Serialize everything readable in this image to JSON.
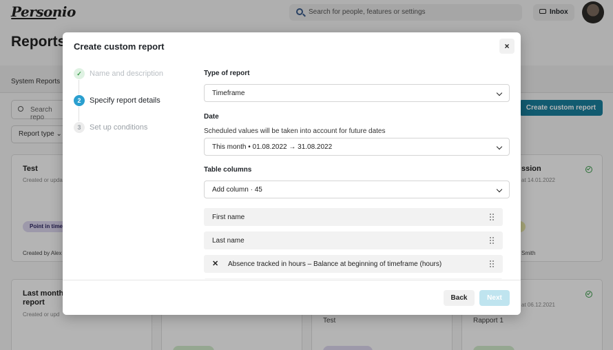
{
  "app": {
    "logo": "Personio",
    "search_placeholder": "Search for people, features or settings",
    "inbox_label": "Inbox",
    "page_title": "Reports",
    "tab_system_reports": "System Reports",
    "search_reports_placeholder": "Search repo",
    "report_type_filter": "Report type",
    "create_button": "Create custom report",
    "cards": [
      {
        "title": "Test",
        "subtitle": "Created or upda",
        "badge": "Point in time",
        "footer": "Created by Alex"
      },
      {
        "title": "ssion",
        "subtitle": "at 14.01.2022",
        "footer": "Smith"
      },
      {
        "title": "Last month report",
        "subtitle": "Created or upd"
      },
      {
        "title": "Test"
      },
      {
        "title": "Rapport 1",
        "subtitle": "at 06.12.2021"
      }
    ]
  },
  "modal": {
    "title": "Create custom report",
    "close_label": "×",
    "steps": [
      {
        "number": "✓",
        "label": "Name and description",
        "state": "done"
      },
      {
        "number": "2",
        "label": "Specify report details",
        "state": "active"
      },
      {
        "number": "3",
        "label": "Set up conditions",
        "state": "pending"
      }
    ],
    "type_of_report": {
      "label": "Type of report",
      "value": "Timeframe"
    },
    "date": {
      "label": "Date",
      "help": "Scheduled values will be taken into account for future dates",
      "value": "This month • 01.08.2022 → 31.08.2022"
    },
    "table_columns": {
      "label": "Table columns",
      "add_column": "Add column · 45",
      "columns": [
        {
          "name": "First name",
          "removable": false
        },
        {
          "name": "Last name",
          "removable": false
        },
        {
          "name": "Absence tracked in hours – Balance at beginning of timeframe (hours)",
          "removable": true
        }
      ]
    },
    "back_label": "Back",
    "next_label": "Next"
  },
  "colors": {
    "accent": "#1a7e9c",
    "step_active": "#2a9fcf",
    "step_done_bg": "#dff2e3",
    "next_disabled": "#bfe4ef"
  }
}
